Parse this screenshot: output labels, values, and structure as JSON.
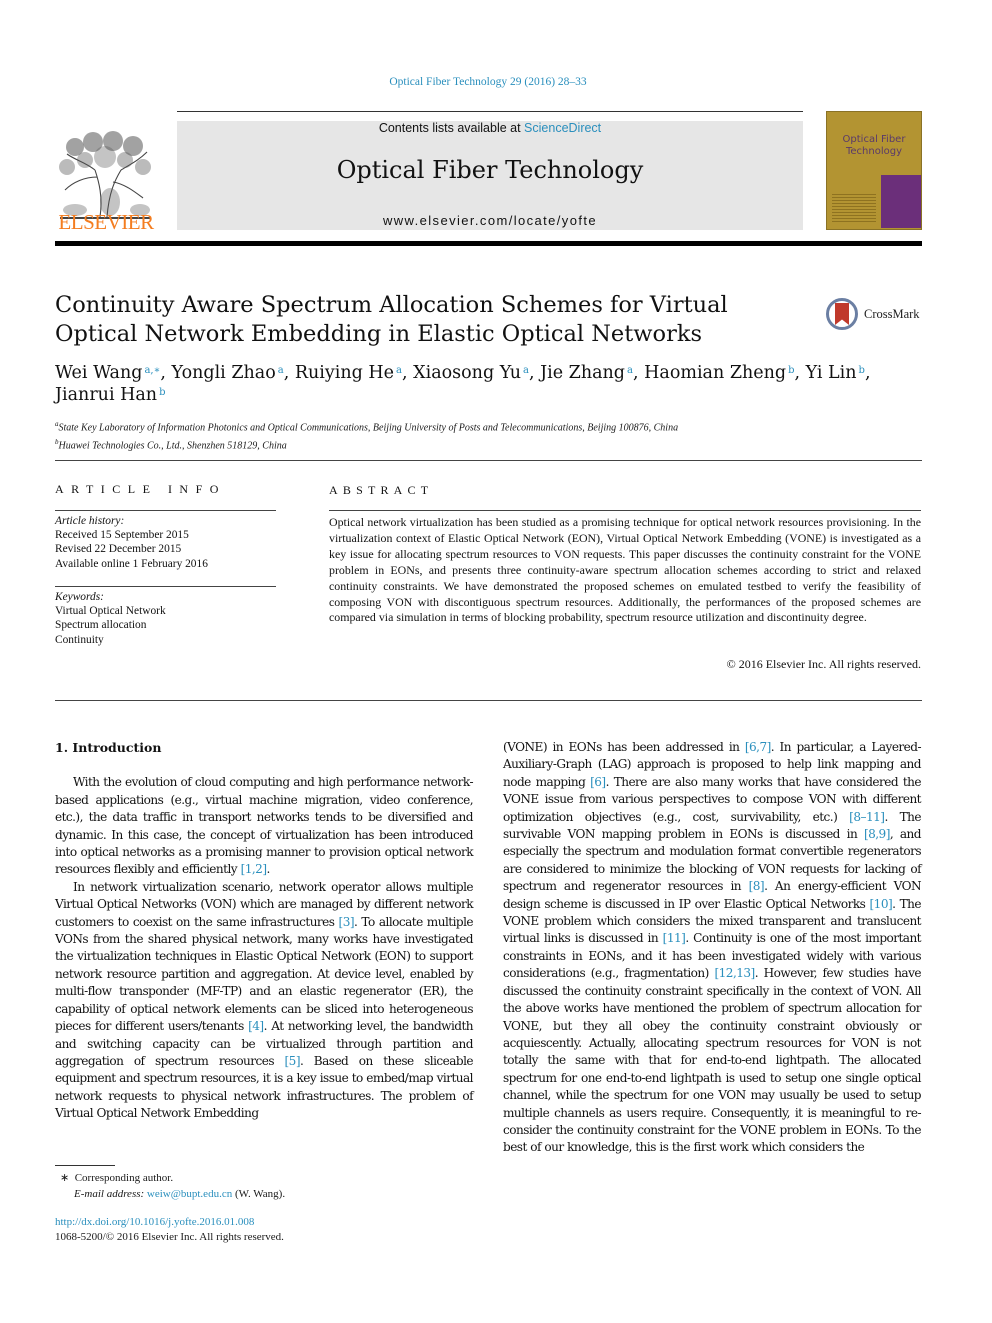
{
  "header": {
    "journal_ref": "Optical Fiber Technology 29 (2016) 28–33",
    "contents_prefix": "Contents lists available at ",
    "contents_link": "ScienceDirect",
    "journal_title": "Optical Fiber Technology",
    "journal_url": "www.elsevier.com/locate/yofte",
    "publisher_logo_text": "ELSEVIER",
    "cover": {
      "title_line1": "Optical Fiber",
      "title_line2": "Technology"
    },
    "colors": {
      "link": "#2a8fbd",
      "elsevier_orange": "#f47d20",
      "cover": "#b39432"
    }
  },
  "article": {
    "title": "Continuity Aware Spectrum Allocation Schemes for Virtual Optical Network Embedding in Elastic Optical Networks",
    "crossmark_label": "CrossMark",
    "authors": [
      {
        "name": "Wei Wang",
        "sup": "a,∗"
      },
      {
        "name": "Yongli Zhao",
        "sup": "a"
      },
      {
        "name": "Ruiying He",
        "sup": "a"
      },
      {
        "name": "Xiaosong Yu",
        "sup": "a"
      },
      {
        "name": "Jie Zhang",
        "sup": "a"
      },
      {
        "name": "Haomian Zheng",
        "sup": "b"
      },
      {
        "name": "Yi Lin",
        "sup": "b"
      },
      {
        "name": "Jianrui Han",
        "sup": "b"
      }
    ],
    "affiliations": [
      {
        "sup": "a",
        "text": "State Key Laboratory of Information Photonics and Optical Communications, Beijing University of Posts and Telecommunications, Beijing 100876, China"
      },
      {
        "sup": "b",
        "text": "Huawei Technologies Co., Ltd., Shenzhen 518129, China"
      }
    ]
  },
  "article_info": {
    "heading": "ARTICLE INFO",
    "history_label": "Article history:",
    "history": [
      "Received 15 September 2015",
      "Revised 22 December 2015",
      "Available online 1 February 2016"
    ],
    "keywords_label": "Keywords:",
    "keywords": [
      "Virtual Optical Network",
      "Spectrum allocation",
      "Continuity"
    ]
  },
  "abstract": {
    "heading": "ABSTRACT",
    "text": "Optical network virtualization has been studied as a promising technique for optical network resources provisioning. In the virtualization context of Elastic Optical Network (EON), Virtual Optical Network Embedding (VONE) is investigated as a key issue for allocating spectrum resources to VON requests. This paper discusses the continuity constraint for the VONE problem in EONs, and presents three continuity-aware spectrum allocation schemes according to strict and relaxed continuity constraints. We have demonstrated the proposed schemes on emulated testbed to verify the feasibility of composing VON with discontiguous spectrum resources. Additionally, the performances of the proposed schemes are compared via simulation in terms of blocking probability, spectrum resource utilization and discontinuity degree.",
    "copyright": "© 2016 Elsevier Inc. All rights reserved."
  },
  "body": {
    "section_heading": "1. Introduction",
    "left_paragraphs": [
      [
        {
          "t": "With the evolution of cloud computing and high performance network-based applications (e.g., virtual machine migration, video conference, etc.), the data traffic in transport networks tends to be diversified and dynamic. In this case, the concept of virtualization has been introduced into optical networks as a promising manner to provision optical network resources flexibly and efficiently "
        },
        {
          "ref": "[1,2]"
        },
        {
          "t": "."
        }
      ],
      [
        {
          "t": "In network virtualization scenario, network operator allows multiple Virtual Optical Networks (VON) which are managed by different network customers to coexist on the same infrastructures "
        },
        {
          "ref": "[3]"
        },
        {
          "t": ". To allocate multiple VONs from the shared physical network, many works have investigated the virtualization techniques in Elastic Optical Network (EON) to support network resource partition and aggregation. At device level, enabled by multi-flow transponder (MF-TP) and an elastic regenerator (ER), the capability of optical network elements can be sliced into heterogeneous pieces for different users/tenants "
        },
        {
          "ref": "[4]"
        },
        {
          "t": ". At networking level, the bandwidth and switching capacity can be virtualized through partition and aggregation of spectrum resources "
        },
        {
          "ref": "[5]"
        },
        {
          "t": ". Based on these sliceable equipment and spectrum resources, it is a key issue to embed/map virtual network requests to physical network infrastructures. The problem of Virtual Optical Network Embedding"
        }
      ]
    ],
    "right_paragraphs": [
      [
        {
          "t": "(VONE) in EONs has been addressed in "
        },
        {
          "ref": "[6,7]"
        },
        {
          "t": ". In particular, a Layered-Auxiliary-Graph (LAG) approach is proposed to help link mapping and node mapping "
        },
        {
          "ref": "[6]"
        },
        {
          "t": ". There are also many works that have considered the VONE issue from various perspectives to compose VON with different optimization objectives (e.g., cost, survivability, etc.) "
        },
        {
          "ref": "[8–11]"
        },
        {
          "t": ". The survivable VON mapping problem in EONs is discussed in "
        },
        {
          "ref": "[8,9]"
        },
        {
          "t": ", and especially the spectrum and modulation format convertible regenerators are considered to minimize the blocking of VON requests for lacking of spectrum and regenerator resources in "
        },
        {
          "ref": "[8]"
        },
        {
          "t": ". An energy-efficient VON design scheme is discussed in IP over Elastic Optical Networks "
        },
        {
          "ref": "[10]"
        },
        {
          "t": ". The VONE problem which considers the mixed transparent and translucent virtual links is discussed in "
        },
        {
          "ref": "[11]"
        },
        {
          "t": ". Continuity is one of the most important constraints in EONs, and it has been investigated widely with various considerations (e.g., fragmentation) "
        },
        {
          "ref": "[12,13]"
        },
        {
          "t": ". However, few studies have discussed the continuity constraint specifically in the context of VON. All the above works have mentioned the problem of spectrum allocation for VONE, but they all obey the continuity constraint obviously or acquiescently. Actually, allocating spectrum resources for VON is not totally the same with that for end-to-end lightpath. The allocated spectrum for one end-to-end lightpath is used to setup one single optical channel, while the spectrum for one VON may usually be used to setup multiple channels as users require. Consequently, it is meaningful to re-consider the continuity constraint for the VONE problem in EONs. To the best of our knowledge, this is the first work which considers the"
        }
      ]
    ]
  },
  "footnotes": {
    "corresponding_mark": "∗",
    "corresponding": "Corresponding author.",
    "email_label": "E-mail address:",
    "email": "weiw@bupt.edu.cn",
    "email_suffix": " (W. Wang).",
    "doi": "http://dx.doi.org/10.1016/j.yofte.2016.01.008",
    "issn_copyright": "1068-5200/© 2016 Elsevier Inc. All rights reserved."
  }
}
